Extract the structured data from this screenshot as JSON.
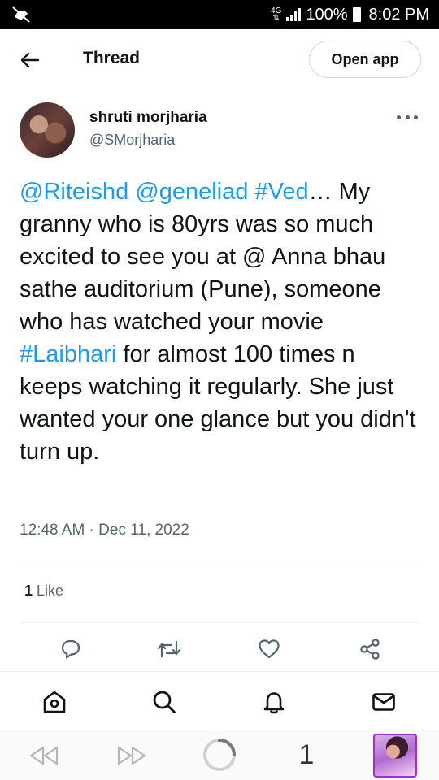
{
  "status_bar": {
    "network": "4G",
    "battery": "100%",
    "time": "8:02 PM"
  },
  "header": {
    "title": "Thread",
    "open_app_label": "Open app"
  },
  "tweet": {
    "author_name": "shruti morjharia",
    "author_handle": "@SMorjharia",
    "text_segments": {
      "mention1": "@Riteishd",
      "mention2": "@geneliad",
      "hashtag1": "#Ved",
      "part1": "… My granny who is 80yrs was so much excited to see you at @ Anna bhau sathe auditorium (Pune), someone who has watched your movie ",
      "hashtag2": "#Laibhari",
      "part2": " for almost 100 times n keeps watching it regularly. She just wanted your one glance but you didn't turn up."
    },
    "timestamp": "12:48 AM · Dec 11, 2022",
    "like_count": "1",
    "like_label": "Like"
  },
  "icons": {
    "back": "arrow-left-icon",
    "more": "more-dots-icon",
    "reply": "reply-icon",
    "retweet": "retweet-icon",
    "like": "heart-icon",
    "share": "share-icon",
    "home": "home-icon",
    "search": "search-icon",
    "notifications": "bell-icon",
    "messages": "mail-icon"
  },
  "browser_bar": {
    "tab_count": "1"
  },
  "colors": {
    "link": "#1d9bf0",
    "secondary_text": "#536471",
    "primary_text": "#0f1419"
  }
}
